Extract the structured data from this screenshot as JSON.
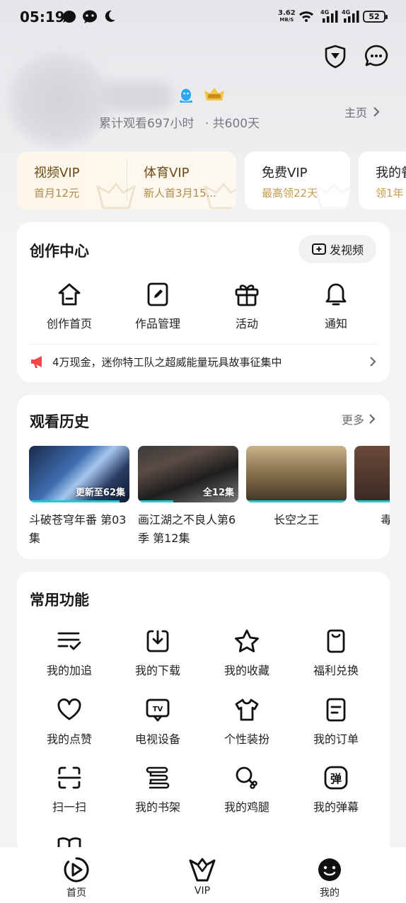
{
  "status_bar": {
    "time": "05:19",
    "net_speed_value": "3.62",
    "net_speed_unit": "MB/S",
    "signal_label_1": "4G",
    "signal_label_2": "4G",
    "battery": "52"
  },
  "profile": {
    "watch_stats": "累计观看697小时",
    "days_stats": "· 共600天",
    "home_link": "主页"
  },
  "vip_cards": [
    {
      "title": "视频VIP",
      "subtitle": "首月12元"
    },
    {
      "title": "体育VIP",
      "subtitle": "新人首3月15..."
    },
    {
      "title": "免费VIP",
      "subtitle": "最高领22天"
    },
    {
      "title": "我的餐",
      "subtitle": "领1年"
    }
  ],
  "creation_center": {
    "title": "创作中心",
    "post_button": "发视频",
    "items": [
      {
        "label": "创作首页",
        "icon": "home-icon"
      },
      {
        "label": "作品管理",
        "icon": "edit-icon"
      },
      {
        "label": "活动",
        "icon": "gift-icon"
      },
      {
        "label": "通知",
        "icon": "bell-icon"
      }
    ],
    "notice": "4万现金，迷你特工队之超威能量玩具故事征集中"
  },
  "history": {
    "title": "观看历史",
    "more": "更多",
    "items": [
      {
        "title": "斗破苍穹年番 第03集",
        "badge": "更新至62集",
        "progress": 0.9
      },
      {
        "title": "画江湖之不良人第6季 第12集",
        "badge": "全12集",
        "progress": 0.35
      },
      {
        "title": "长空之王",
        "badge": "",
        "progress": 1.0
      },
      {
        "title": "毒",
        "badge": "",
        "progress": 0.5
      }
    ]
  },
  "common": {
    "title": "常用功能",
    "items": [
      {
        "label": "我的加追",
        "icon": "list-check-icon"
      },
      {
        "label": "我的下载",
        "icon": "download-icon"
      },
      {
        "label": "我的收藏",
        "icon": "star-icon"
      },
      {
        "label": "福利兑换",
        "icon": "coupon-icon"
      },
      {
        "label": "我的点赞",
        "icon": "heart-icon"
      },
      {
        "label": "电视设备",
        "icon": "tv-icon"
      },
      {
        "label": "个性装扮",
        "icon": "shirt-icon"
      },
      {
        "label": "我的订单",
        "icon": "order-icon"
      },
      {
        "label": "扫一扫",
        "icon": "scan-icon"
      },
      {
        "label": "我的书架",
        "icon": "bookshelf-icon"
      },
      {
        "label": "我的鸡腿",
        "icon": "drumstick-icon"
      },
      {
        "label": "我的弹幕",
        "icon": "danmaku-icon"
      }
    ],
    "danmaku_glyph": "弹"
  },
  "tabbar": {
    "tabs": [
      {
        "label": "首页",
        "icon": "play-icon"
      },
      {
        "label": "VIP",
        "icon": "crown-icon"
      },
      {
        "label": "我的",
        "icon": "profile-face-icon"
      }
    ]
  },
  "colors": {
    "accent_cyan": "#25c7d6",
    "vip_gold": "#b08a4a",
    "notice_red": "#f04848"
  }
}
